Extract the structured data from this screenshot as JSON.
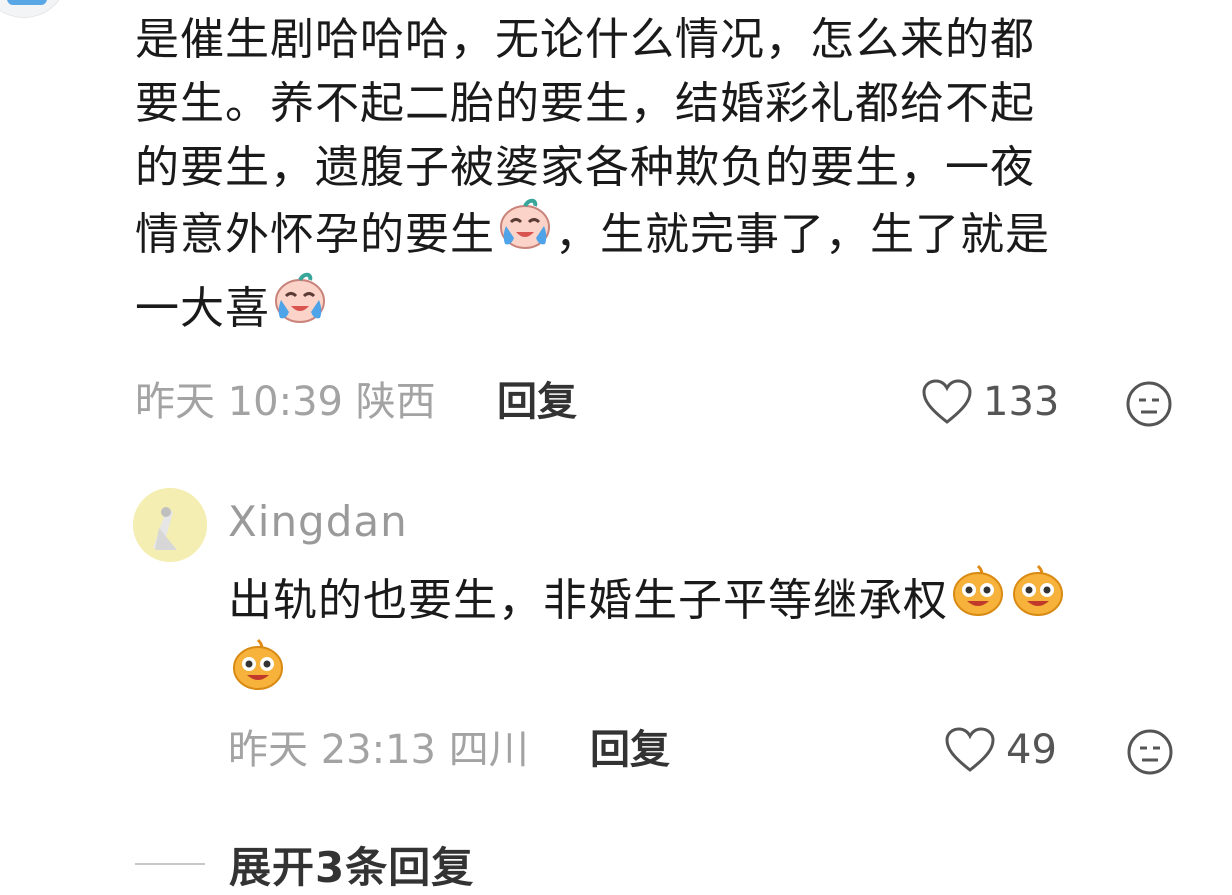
{
  "comment": {
    "segments": {
      "line1": "是催生剧哈哈哈，无论什么情况，怎么来的都",
      "line2": "要生。养不起二胎的要生，结婚彩礼都给不起",
      "line3": "的要生，遗腹子被婆家各种欺负的要生，一夜",
      "line4a": "情意外怀孕的要生",
      "line4b": "，生就完事了，生了就是",
      "line5": "一大喜"
    },
    "emoji_icon": "crying-laughing-face-icon",
    "meta": {
      "time": "昨天 10:39",
      "location": "陕西",
      "reply_label": "回复",
      "like_count": "133"
    }
  },
  "reply": {
    "username": "Xingdan",
    "text_line1": "出轨的也要生，非婚生子平等继承权",
    "emoji_icon": "grinning-face-icon",
    "meta": {
      "time": "昨天 23:13",
      "location": "四川",
      "reply_label": "回复",
      "like_count": "49"
    }
  },
  "expand": {
    "label": "展开3条回复"
  },
  "colors": {
    "text": "#1a1a1a",
    "meta": "#a3a3a3",
    "action": "#333333",
    "emoji_orange": "#f5a623"
  }
}
